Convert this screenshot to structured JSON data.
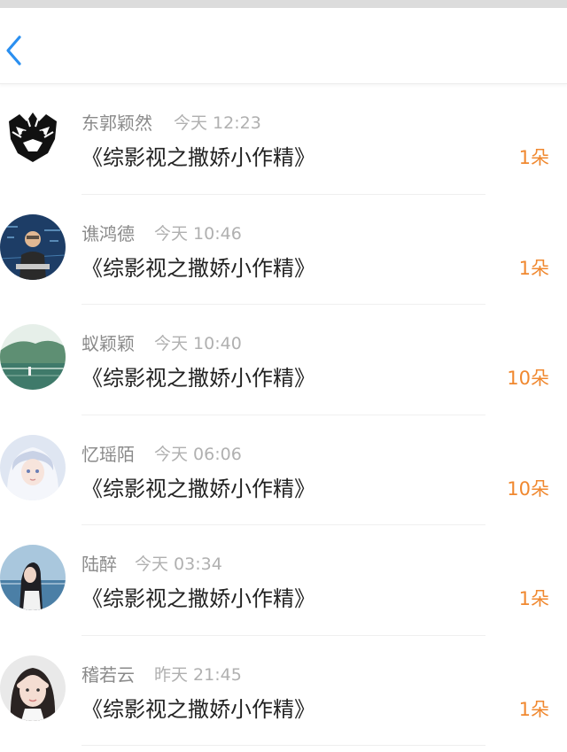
{
  "header": {
    "back_icon": "chevron-left-icon",
    "accent": "#2a8ff0"
  },
  "colors": {
    "amount": "#f0882f",
    "name": "#8a8a8a",
    "time": "#b0b0b0",
    "title": "#222222"
  },
  "items": [
    {
      "name": "东郭颖然",
      "time": "今天 12:23",
      "title": "《综影视之撒娇小作精》",
      "amount": "1朵",
      "avatar": "tiger-avatar"
    },
    {
      "name": "谯鸿德",
      "time": "今天 10:46",
      "title": "《综影视之撒娇小作精》",
      "amount": "1朵",
      "avatar": "man-at-computer-avatar"
    },
    {
      "name": "蚁颖颖",
      "time": "今天 10:40",
      "title": "《综影视之撒娇小作精》",
      "amount": "10朵",
      "avatar": "landscape-avatar"
    },
    {
      "name": "忆瑶陌",
      "time": "今天 06:06",
      "title": "《综影视之撒娇小作精》",
      "amount": "10朵",
      "avatar": "anime-girl-avatar"
    },
    {
      "name": "陆醉",
      "time": "今天 03:34",
      "title": "《综影视之撒娇小作精》",
      "amount": "1朵",
      "avatar": "girl-by-sea-avatar"
    },
    {
      "name": "稽若云",
      "time": "昨天 21:45",
      "title": "《综影视之撒娇小作精》",
      "amount": "1朵",
      "avatar": "girl-selfie-avatar"
    }
  ]
}
